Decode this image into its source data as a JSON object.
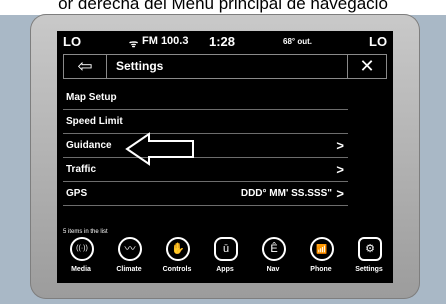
{
  "caption": "or derecha del Menú principal de navegació",
  "status": {
    "left": "LO",
    "radio": "FM 100.3",
    "time": "1:28",
    "temp": "68° out.",
    "right": "LO",
    "radio_icon": "antenna-icon"
  },
  "header": {
    "title": "Settings",
    "back_glyph": "⇦",
    "close_glyph": "✕"
  },
  "menu": [
    {
      "label": "Map Setup",
      "value": "",
      "chevron": ""
    },
    {
      "label": "Speed Limit",
      "value": "",
      "chevron": ""
    },
    {
      "label": "Guidance",
      "value": "",
      "chevron": ">"
    },
    {
      "label": "Traffic",
      "value": "",
      "chevron": ">"
    },
    {
      "label": "GPS",
      "value": "DDD° MM' SS.SSS\"",
      "chevron": ">"
    }
  ],
  "count_text": "5 items in the list",
  "tabs": [
    {
      "label": "Media",
      "icon": "radio-icon",
      "glyph": "((·))"
    },
    {
      "label": "Climate",
      "icon": "climate-icon",
      "glyph": "〰"
    },
    {
      "label": "Controls",
      "icon": "controls-icon",
      "glyph": "✋"
    },
    {
      "label": "Apps",
      "icon": "apps-icon",
      "glyph": "ū"
    },
    {
      "label": "Nav",
      "icon": "nav-icon",
      "glyph": "Ê"
    },
    {
      "label": "Phone",
      "icon": "phone-icon",
      "glyph": "📶"
    },
    {
      "label": "Settings",
      "icon": "settings-icon",
      "glyph": "⚙"
    }
  ]
}
